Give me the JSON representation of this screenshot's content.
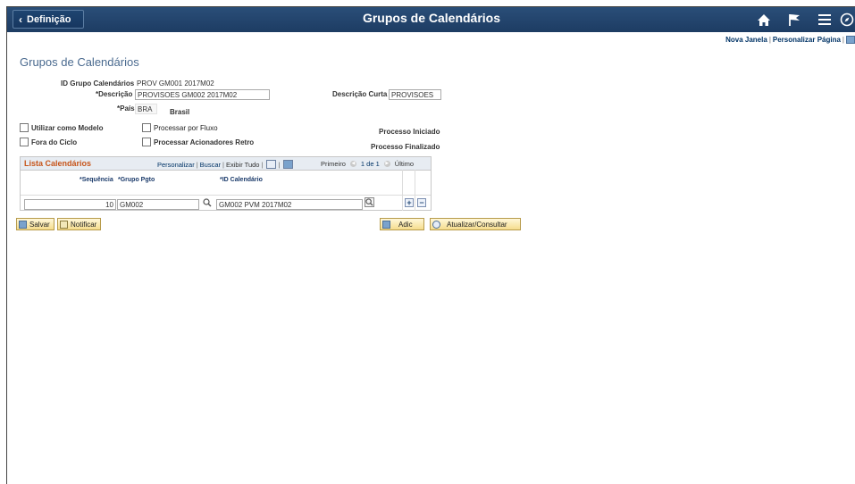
{
  "header": {
    "back_label": "Definição",
    "title": "Grupos de Calendários",
    "icons": [
      "home-icon",
      "flag-icon",
      "menu-icon",
      "compass-icon"
    ]
  },
  "links": {
    "new_window": "Nova Janela",
    "personalize_page": "Personalizar Página"
  },
  "page": {
    "title": "Grupos de Calendários"
  },
  "form": {
    "id_label": "ID Grupo Calendários",
    "id_value": "PROV GM001 2017M02",
    "desc_label": "*Descrição",
    "desc_value": "PROVISOES GM002 2017M02",
    "short_desc_label": "Descrição Curta",
    "short_desc_value": "PROVISOES",
    "country_label": "*País",
    "country_value": "BRA",
    "country_name": "Brasil",
    "use_as_model": "Utilizar como Modelo",
    "process_flow": "Processar por Fluxo",
    "off_cycle": "Fora do Ciclo",
    "process_retro": "Processar Acionadores Retro",
    "process_started": "Processo Iniciado",
    "process_finished": "Processo Finalizado"
  },
  "grid": {
    "title": "Lista Calendários",
    "personalize": "Personalizar",
    "search": "Buscar",
    "show_all": "Exibir Tudo",
    "first": "Primeiro",
    "page_info": "1 de 1",
    "last": "Último",
    "columns": [
      "*Sequência",
      "*Grupo Pgto",
      "*ID Calendário"
    ],
    "rows": [
      {
        "seq": "10",
        "paygroup": "GM002",
        "calendar_id": "GM002 PVM 2017M02"
      }
    ]
  },
  "buttons": {
    "save": "Salvar",
    "notify": "Notificar",
    "add": "Adic",
    "update": "Atualizar/Consultar"
  },
  "colors": {
    "header_bg": "#1d3c63",
    "grid_title": "#c7551b",
    "button_bg": "#f5dd8d"
  }
}
